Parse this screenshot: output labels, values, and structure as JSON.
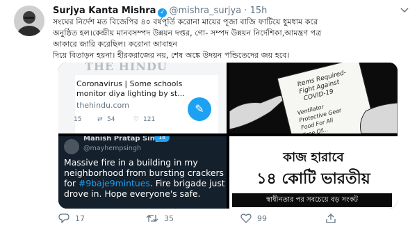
{
  "tweet": {
    "author_name": "Surjya Kanta Mishra",
    "handle": "@mishra_surjya",
    "separator": "·",
    "time": "15h",
    "text_lines": [
      "সংঘের নির্দেশ মত বিজেপির ৪০ বর্ষপূর্তি  করোনা মায়ের পূজা বাজি ফাটিয়ে ধুমধাম করে",
      "অনুষ্ঠিত হল।কেন্দ্রীয় মানবসম্পদ উন্নয়ন দপ্তর, গো- সম্পদ উন্নয়ন নির্দেশিকা,আমন্ত্রণ পত্র",
      "আকারে জারি করেছিল।  করোনা আবাহন",
      "দিয়ে বিতাড়ন হয়না। হীরকরাজের নয়, শেষ অঙ্কে উদয়ন পন্ডিতেদের জয় হবে।"
    ]
  },
  "media": {
    "hindu_card": {
      "masthead": "THE HINDU",
      "headline": "Coronavirus | Some schools monitor diya lighting by st...",
      "site": "thehindu.com",
      "reply_count": "15",
      "retweet_count": "54",
      "like_count": "121"
    },
    "covid_list": {
      "title_line1": "Items Required-",
      "title_line2": "Fight Against",
      "title_line3": "COVID-19",
      "items": [
        "Ventilator",
        "Protective Gear",
        "Food For All",
        "Free Of..."
      ]
    },
    "quoted_tweet": {
      "name": "Manish Pratap Singh",
      "handle": "@mayhempsingh",
      "text_before": "Massive fire in a building in my neighborhood from bursting crackers for ",
      "hashtag": "#9baje9mintues",
      "text_after": ". Fire brigade just drove in. Hope everyone's safe.",
      "counter": "18"
    },
    "poster": {
      "line1": "কাজ হারাবে",
      "line2": "১৪ কোটি ভারতীয়",
      "band": "স্বাধীনতার পর সবচেয়ে বড় সংকট"
    }
  },
  "actions": {
    "reply_count": "17",
    "retweet_count": "35",
    "like_count": "99"
  },
  "colors": {
    "accent": "#1da1f2",
    "muted": "#657786"
  }
}
